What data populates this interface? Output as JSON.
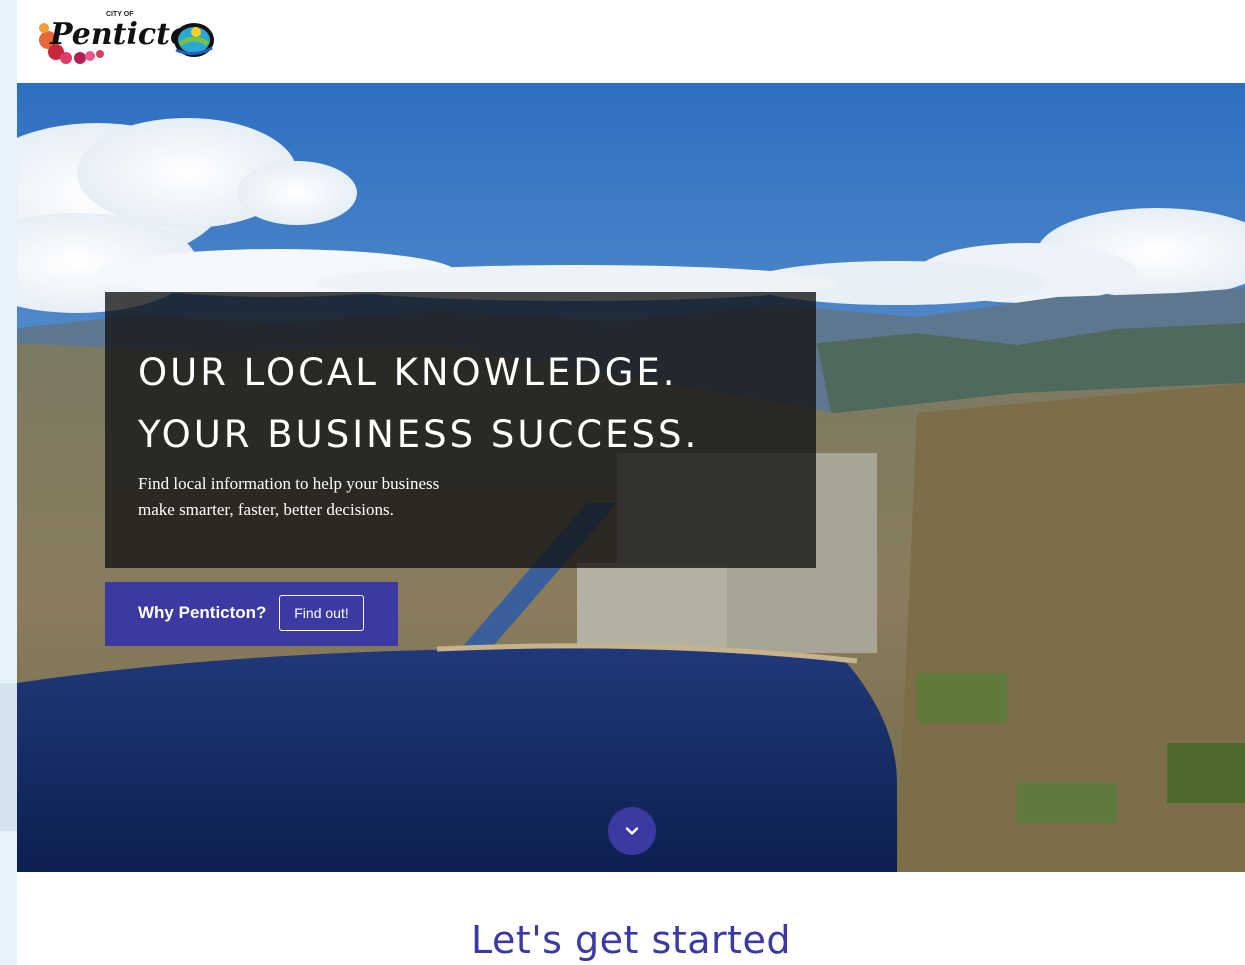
{
  "header": {
    "logo": {
      "small_text": "CITY OF",
      "wordmark": "Penticton"
    }
  },
  "hero": {
    "headline_line1": "OUR LOCAL KNOWLEDGE.",
    "headline_line2": "YOUR BUSINESS SUCCESS.",
    "subtext_line1": "Find local information to help your business",
    "subtext_line2": "make smarter, faster, better decisions.",
    "cta_label": "Why Penticton?",
    "cta_button": "Find out!",
    "scroll_icon": "chevron-down-icon"
  },
  "section": {
    "title": "Let's get started"
  },
  "colors": {
    "brand": "#3b3aa3",
    "overlay": "#121212",
    "edge_strip": "#e6f2fa"
  }
}
